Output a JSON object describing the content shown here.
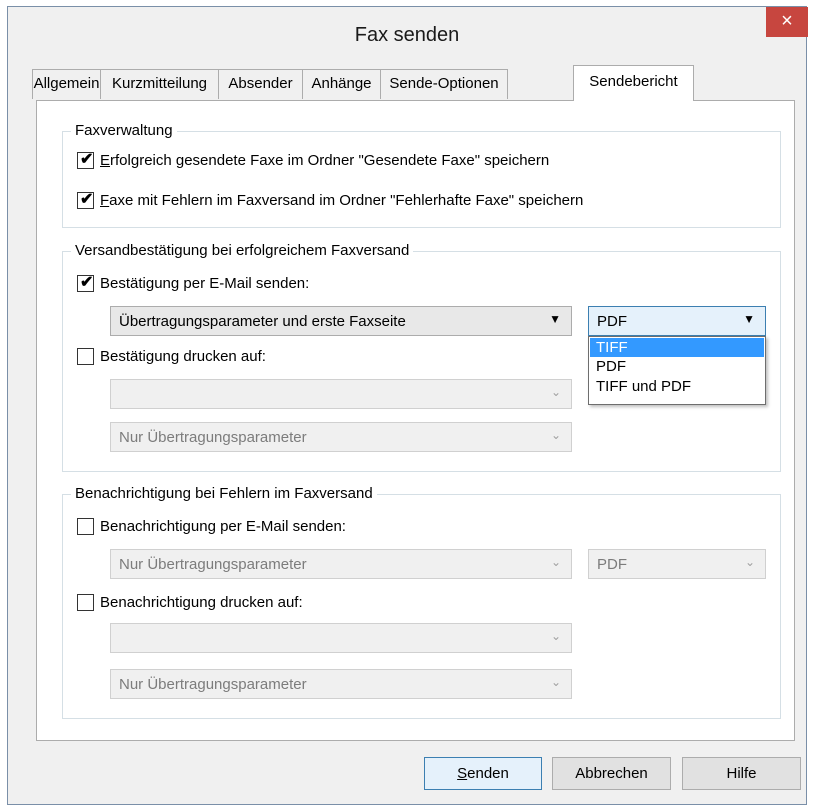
{
  "window": {
    "title": "Fax senden",
    "close_glyph": "×"
  },
  "tabs": [
    {
      "label": "Allgemein"
    },
    {
      "label": "Kurzmitteilung"
    },
    {
      "label": "Absender"
    },
    {
      "label": "Anhänge"
    },
    {
      "label": "Sende-Optionen"
    },
    {
      "label": "Sendebericht",
      "active": true
    }
  ],
  "faxverwaltung": {
    "title": "Faxverwaltung",
    "save_sent": {
      "mnemonic": "E",
      "label_rest": "rfolgreich gesendete Faxe im Ordner \"Gesendete Faxe\" speichern",
      "checked": true
    },
    "save_failed": {
      "mnemonic": "F",
      "label_rest": "axe mit Fehlern im Faxversand im Ordner \"Fehlerhafte Faxe\" speichern",
      "checked": true
    }
  },
  "versand": {
    "title": "Versandbestätigung bei erfolgreichem Faxversand",
    "email": {
      "label": "Bestätigung per E-Mail senden:",
      "checked": true
    },
    "content_combo": {
      "value": "Übertragungsparameter und erste Faxseite"
    },
    "format_combo": {
      "value": "PDF"
    },
    "format_options": [
      "TIFF",
      "PDF",
      "TIFF und PDF"
    ],
    "format_highlighted": "TIFF",
    "print": {
      "label": "Bestätigung drucken auf:",
      "checked": false
    },
    "printer_combo": {
      "value": ""
    },
    "print_content_combo": {
      "value": "Nur Übertragungsparameter"
    }
  },
  "benachrichtigung": {
    "title": "Benachrichtigung bei Fehlern im Faxversand",
    "email": {
      "label": "Benachrichtigung per E-Mail senden:",
      "checked": false
    },
    "content_combo": {
      "value": "Nur Übertragungsparameter"
    },
    "format_combo": {
      "value": "PDF"
    },
    "print": {
      "label": "Benachrichtigung drucken auf:",
      "checked": false
    },
    "printer_combo": {
      "value": ""
    },
    "print_content_combo": {
      "value": "Nur Übertragungsparameter"
    }
  },
  "buttons": {
    "send": {
      "mnemonic": "S",
      "label_rest": "enden"
    },
    "cancel": "Abbrechen",
    "help": "Hilfe"
  },
  "icons": {
    "check": "✔",
    "chevron": "⌄"
  },
  "colors": {
    "close_button": "#c7463f",
    "selection": "#3399ff",
    "focus_border": "#3c7fb1"
  }
}
